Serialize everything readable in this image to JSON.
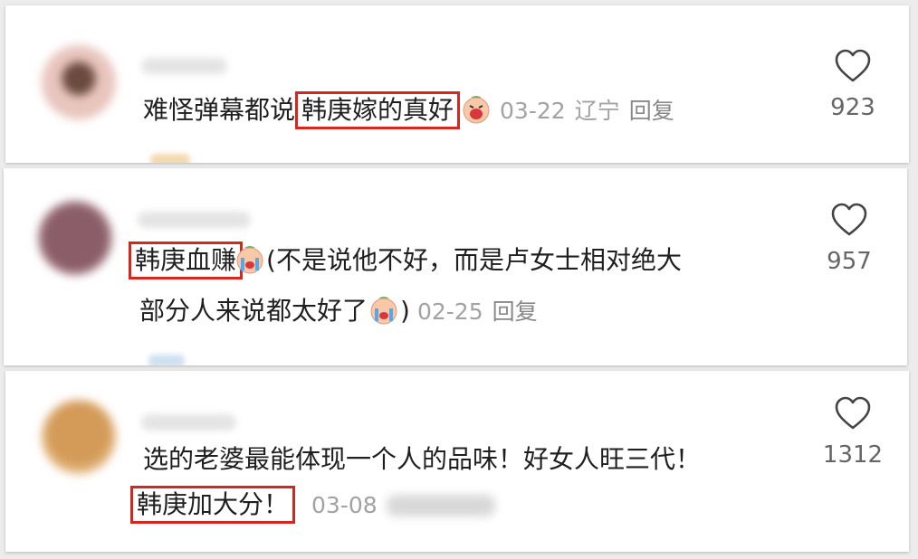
{
  "comments": [
    {
      "before": "难怪弹幕都说",
      "highlight": "韩庚嫁的真好",
      "after": "",
      "emoji": "face-screaming-emoji",
      "date": "03-22",
      "location": "辽宁",
      "reply": "回复",
      "likes": "923",
      "avatar_color": "#c9a6a2"
    },
    {
      "before": "",
      "highlight": "韩庚血赚",
      "after": "(不是说他不好，而是卢女士相对绝大",
      "line2": "部分人来说都太好了",
      "line2_after": ")",
      "emoji": "face-crying-emoji",
      "date": "02-25",
      "reply": "回复",
      "likes": "957",
      "avatar_color": "#7a4f5a"
    },
    {
      "line1": "选的老婆最能体现一个人的品味！好女人旺三代！",
      "highlight": "韩庚加大分！",
      "date": "03-08",
      "likes": "1312",
      "avatar_color": "#d6a25a"
    }
  ],
  "colors": {
    "highlight_border": "#d4271d",
    "meta_text": "#a2a2a2",
    "body_text": "#1f1f1f"
  }
}
